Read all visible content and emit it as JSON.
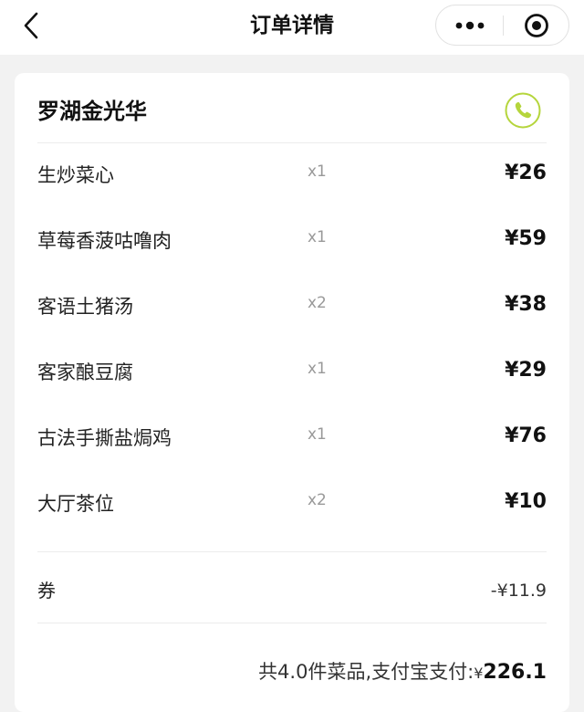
{
  "header": {
    "title": "订单详情",
    "back_icon": "chevron-left-icon",
    "more_icon": "more-dots-icon",
    "close_icon": "target-circle-icon"
  },
  "store": {
    "name": "罗湖金光华",
    "phone_icon": "phone-icon",
    "phone_icon_color": "#b5d53c"
  },
  "items": [
    {
      "name": "生炒菜心",
      "qty": "x1",
      "price": "¥26"
    },
    {
      "name": "草莓香菠咕噜肉",
      "qty": "x1",
      "price": "¥59"
    },
    {
      "name": "客语土猪汤",
      "qty": "x2",
      "price": "¥38"
    },
    {
      "name": "客家酿豆腐",
      "qty": "x1",
      "price": "¥29"
    },
    {
      "name": "古法手撕盐焗鸡",
      "qty": "x1",
      "price": "¥76"
    },
    {
      "name": "大厅茶位",
      "qty": "x2",
      "price": "¥10"
    }
  ],
  "coupon": {
    "label": "券",
    "value": "-¥11.9"
  },
  "summary": {
    "text": "共4.0件菜品,支付宝支付:",
    "currency": "¥",
    "amount": "226.1"
  }
}
